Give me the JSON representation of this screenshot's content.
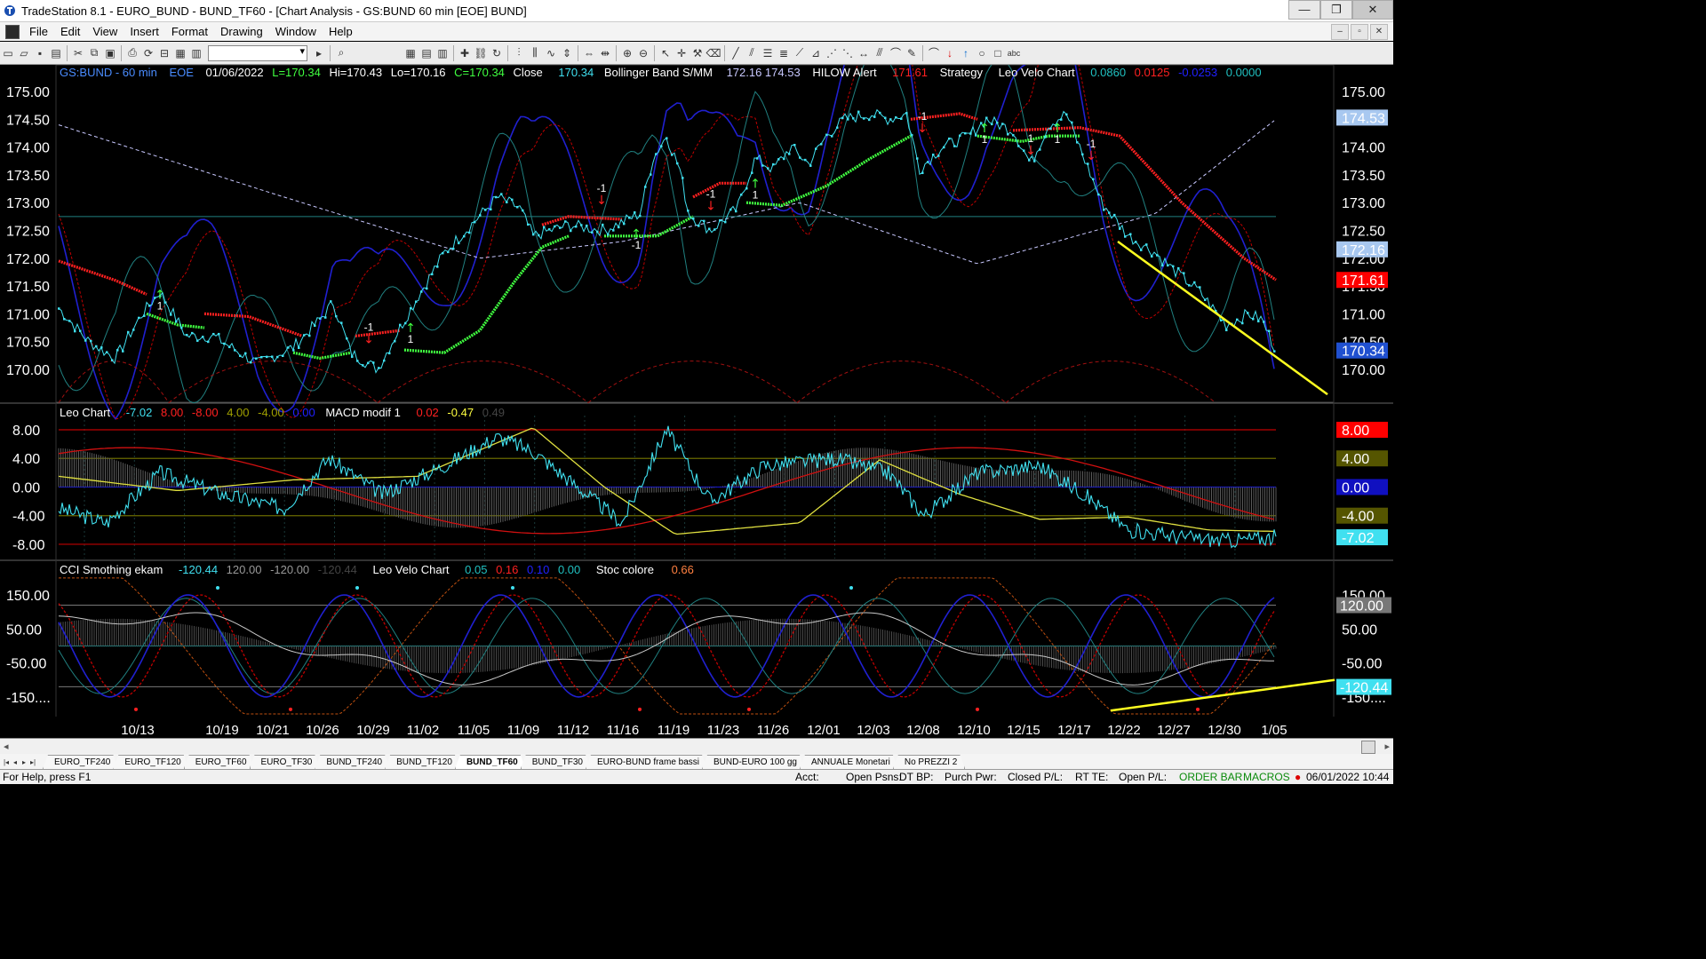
{
  "window": {
    "title": "TradeStation 8.1 - EURO_BUND - BUND_TF60 - [Chart Analysis - GS:BUND  60 min  [EOE] BUND]",
    "minimize": "—",
    "maximize": "❐",
    "close": "✕"
  },
  "menu": [
    "File",
    "Edit",
    "View",
    "Insert",
    "Format",
    "Drawing",
    "Window",
    "Help"
  ],
  "mdi": {
    "minimize": "‒",
    "restore": "▫",
    "close": "✕"
  },
  "toolbar": {
    "icons": [
      "new-icon",
      "open-icon",
      "save-icon",
      "print-icon",
      "cut-icon",
      "copy-icon",
      "paste-icon",
      "lock-icon",
      "properties-icon",
      "search-icon",
      "zoom-in-icon",
      "zoom-out-icon",
      "cursor-icon",
      "trendline-icon",
      "text-icon"
    ]
  },
  "price_pane": {
    "symbol": "GS:BUND - 60 min",
    "session": "EOE",
    "date": "01/06/2022",
    "low_last": "L=170.34",
    "hi": "Hi=170.43",
    "lo": "Lo=170.16",
    "close_val": "C=170.34",
    "close_lbl": "Close",
    "close_num": "170.34",
    "bb_lbl": "Bollinger Band S/MM",
    "bb_vals": "172.16  174.53",
    "hilow_lbl": "HILOW Alert",
    "hilow_val": "171.61",
    "strategy": "Strategy",
    "lvc_lbl": "Leo Velo Chart",
    "lvc_v1": "0.0860",
    "lvc_v2": "0.0125",
    "lvc_v3": "-0.0253",
    "lvc_v4": "0.0000",
    "y_ticks": [
      "175.00",
      "174.50",
      "174.00",
      "173.50",
      "173.00",
      "172.50",
      "172.00",
      "171.50",
      "171.00",
      "170.50",
      "170.00"
    ],
    "axis_boxes": [
      {
        "label": "174.53",
        "color": "#a8c8f0",
        "text_color": "#000000"
      },
      {
        "label": "172.16",
        "color": "#a8c8f0",
        "text_color": "#000000"
      },
      {
        "label": "171.61",
        "color": "#ff0000",
        "text_color": "#ffffff"
      },
      {
        "label": "170.34",
        "color": "#2050d0",
        "text_color": "#ffffff"
      }
    ],
    "signal_labels": [
      "1",
      "-1",
      "1",
      "-1",
      "-1",
      "1",
      "1",
      "-1",
      "1",
      "1",
      "1",
      "-1",
      "1",
      "-1"
    ]
  },
  "macd_pane": {
    "title": "Leo Chart",
    "v1": "-7.02",
    "v2": "8.00",
    "v3": "-8.00",
    "v4": "4.00",
    "v5": "-4.00",
    "v6": "0.00",
    "macd_lbl": "MACD modif 1",
    "m1": "0.02",
    "m2": "-0.47",
    "m3": "0.49",
    "y_ticks": [
      "8.00",
      "4.00",
      "0.00",
      "-4.00",
      "-8.00"
    ],
    "axis_boxes": [
      {
        "label": "8.00",
        "color": "#ff0000",
        "text_color": "#ffffff"
      },
      {
        "label": "4.00",
        "color": "#555500",
        "text_color": "#ffffff"
      },
      {
        "label": "0.00",
        "color": "#1010c0",
        "text_color": "#000000"
      },
      {
        "label": "-4.00",
        "color": "#555500",
        "text_color": "#ffffff"
      },
      {
        "label": "-7.02",
        "color": "#40e0f0",
        "text_color": "#000000"
      }
    ]
  },
  "cci_pane": {
    "title": "CCI Smothing ekam",
    "c1": "-120.44",
    "c2": "120.00",
    "c3": "-120.00",
    "c4": "-120.44",
    "lvc_lbl": "Leo Velo Chart",
    "l1": "0.05",
    "l2": "0.16",
    "l3": "0.10",
    "l4": "0.00",
    "stoc_lbl": "Stoc colore",
    "s1": "0.66",
    "y_ticks": [
      "150.00",
      "50.00",
      "-50.00",
      "-150...."
    ],
    "axis_boxes": [
      {
        "label": "120.00",
        "color": "#777777",
        "text_color": "#ffffff"
      },
      {
        "label": "-120.44",
        "color": "#40e0f0",
        "text_color": "#000000"
      }
    ]
  },
  "x_axis": [
    "10/13",
    "10/19",
    "10/21",
    "10/26",
    "10/29",
    "11/02",
    "11/05",
    "11/09",
    "11/12",
    "11/16",
    "11/19",
    "11/23",
    "11/26",
    "12/01",
    "12/03",
    "12/08",
    "12/10",
    "12/15",
    "12/17",
    "12/22",
    "12/27",
    "12/30",
    "1/05"
  ],
  "colors": {
    "price": "#40e0f0",
    "bollinger_mid": "#c8c8ff",
    "hilow_red": "#ff2020",
    "hilow_green": "#40ff40",
    "trend_yellow": "#ffff20",
    "blue_osc": "#2020d0",
    "red_osc": "#c00000",
    "teal_osc": "#208080"
  },
  "sheet_tabs": [
    "EURO_TF240",
    "EURO_TF120",
    "EURO_TF60",
    "EURO_TF30",
    "BUND_TF240",
    "BUND_TF120",
    "BUND_TF60",
    "BUND_TF30",
    "EURO-BUND frame bassi",
    "BUND-EURO 100 gg",
    "ANNUALE Monetari",
    "No PREZZI 2"
  ],
  "active_tab": "BUND_TF60",
  "status": {
    "help": "For Help, press F1",
    "acct": "Acct:",
    "open_psns": "Open Psns:",
    "dt_bp": "DT BP:",
    "purch_pwr": "Purch Pwr:",
    "closed_pl": "Closed P/L:",
    "rt_te": "RT TE:",
    "open_pl": "Open P/L:",
    "order_bar": "ORDER BAR",
    "macros": "MACROS",
    "datetime": "06/01/2022 10:44"
  }
}
